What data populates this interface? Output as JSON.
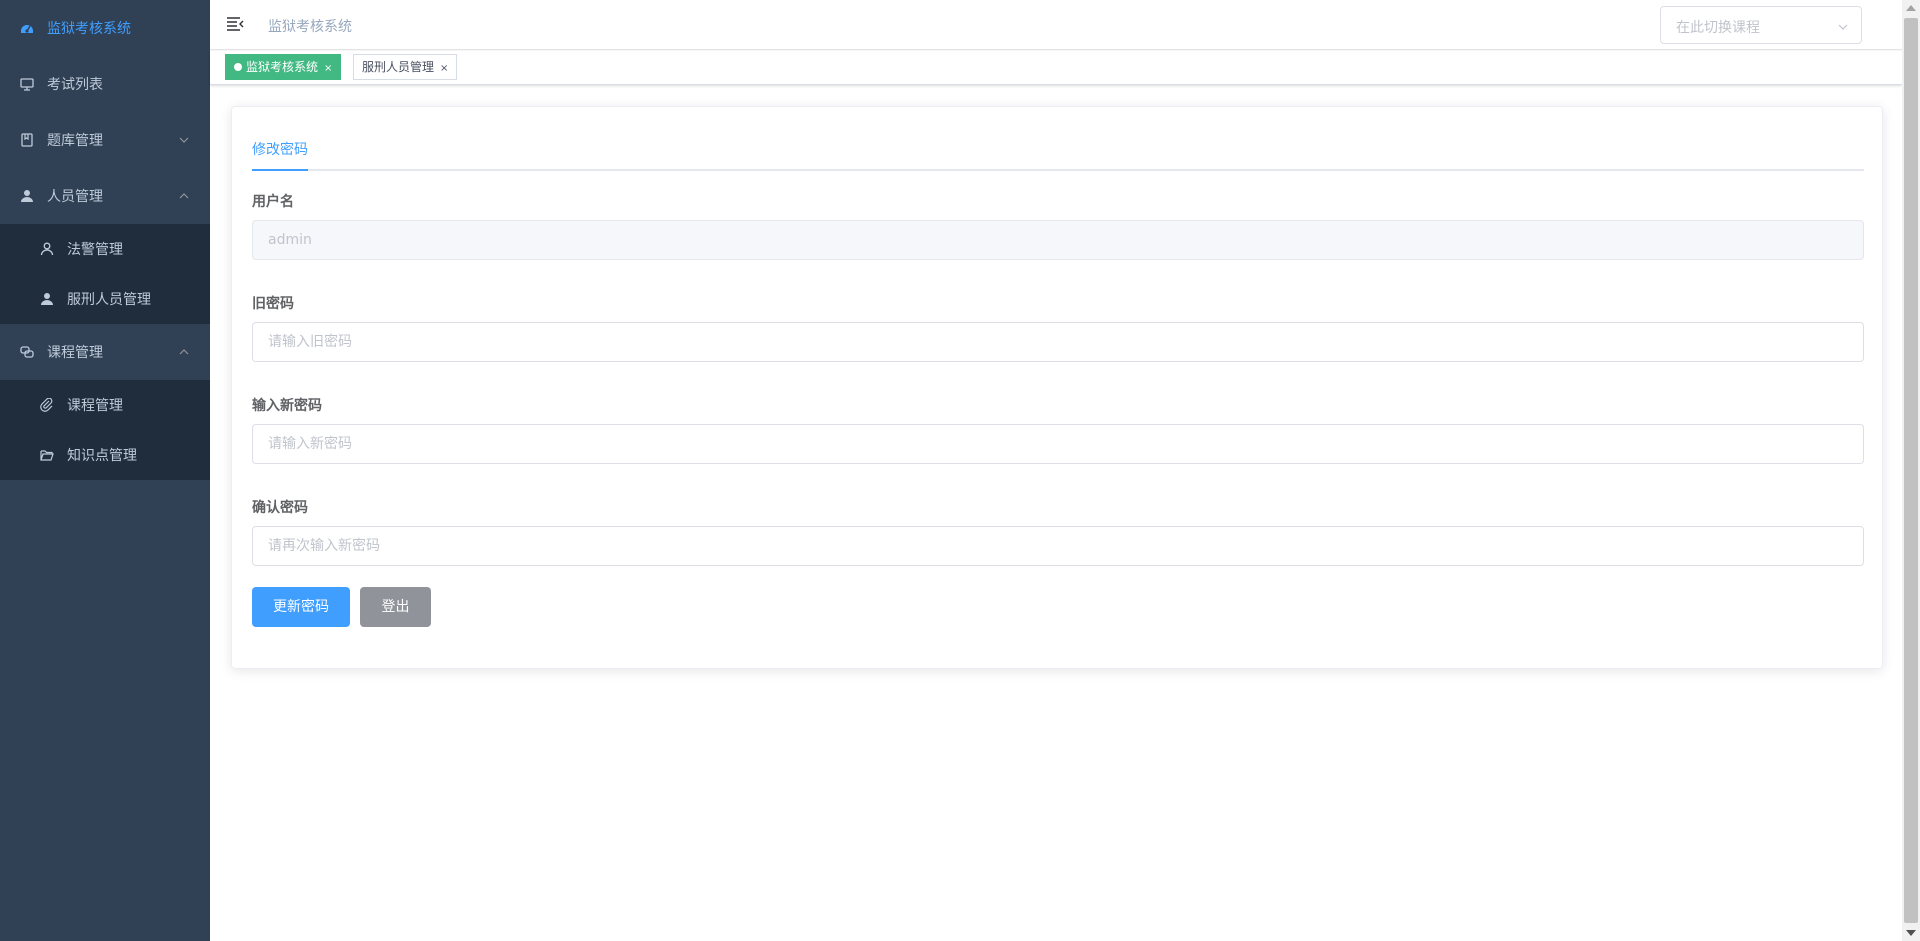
{
  "colors": {
    "sidebar_bg": "#304156",
    "submenu_bg": "#1f2d3d",
    "accent": "#409eff",
    "tag_active": "#42b983",
    "logout": "#909399"
  },
  "sidebar": {
    "items": [
      {
        "label": "监狱考核系统",
        "icon": "dashboard-icon",
        "active": true
      },
      {
        "label": "考试列表",
        "icon": "monitor-icon"
      },
      {
        "label": "题库管理",
        "icon": "book-icon",
        "expanded": false
      },
      {
        "label": "人员管理",
        "icon": "user-filled-icon",
        "expanded": true,
        "children": [
          {
            "label": "法警管理",
            "icon": "user-outline-icon"
          },
          {
            "label": "服刑人员管理",
            "icon": "user-filled-icon"
          }
        ]
      },
      {
        "label": "课程管理",
        "icon": "chat-bubbles-icon",
        "expanded": true,
        "children": [
          {
            "label": "课程管理",
            "icon": "paperclip-icon"
          },
          {
            "label": "知识点管理",
            "icon": "folder-open-icon"
          }
        ]
      }
    ]
  },
  "header": {
    "breadcrumb": "监狱考核系统",
    "course_select_placeholder": "在此切换课程"
  },
  "tags": [
    {
      "label": "监狱考核系统",
      "active": true
    },
    {
      "label": "服刑人员管理",
      "active": false
    }
  ],
  "form": {
    "tab": "修改密码",
    "username_label": "用户名",
    "username_value": "admin",
    "old_password_label": "旧密码",
    "old_password_placeholder": "请输入旧密码",
    "new_password_label": "输入新密码",
    "new_password_placeholder": "请输入新密码",
    "confirm_password_label": "确认密码",
    "confirm_password_placeholder": "请再次输入新密码",
    "update_button": "更新密码",
    "logout_button": "登出"
  }
}
